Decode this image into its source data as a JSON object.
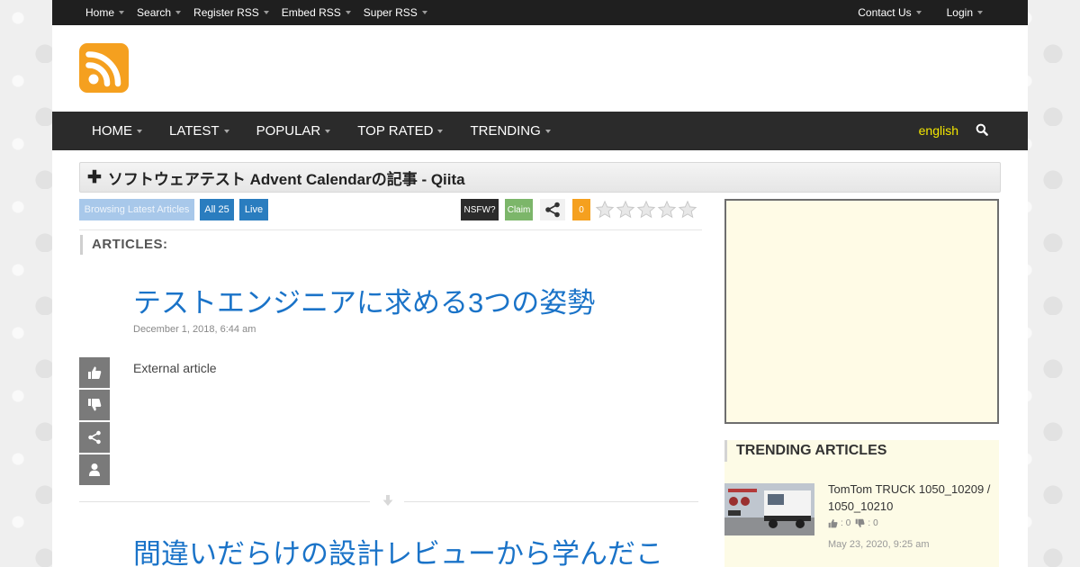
{
  "topbar": {
    "left": [
      "Home",
      "Search",
      "Register RSS",
      "Embed RSS",
      "Super RSS"
    ],
    "right": [
      "Contact Us",
      "Login"
    ]
  },
  "mainnav": {
    "items": [
      "HOME",
      "LATEST",
      "POPULAR",
      "TOP RATED",
      "TRENDING"
    ],
    "language": "english"
  },
  "feed": {
    "title": "ソフトウェアテスト Advent Calendarの記事 - Qiita"
  },
  "toolbar": {
    "browse_label": "Browsing Latest Articles",
    "all_label": "All 25",
    "live_label": "Live",
    "nsfw_label": "NSFW?",
    "claim_label": "Claim",
    "count": "0",
    "rating": 0
  },
  "articles_heading": "ARTICLES:",
  "articles": [
    {
      "title": "テストエンジニアに求める3つの姿勢",
      "date": "December 1, 2018, 6:44 am",
      "body": "External article"
    },
    {
      "title": "間違いだらけの設計レビューから学んだこ"
    }
  ],
  "sidebar": {
    "trending_heading": "TRENDING ARTICLES",
    "trending": [
      {
        "title": "TomTom TRUCK 1050_10209 / 1050_10210",
        "likes": "0",
        "dislikes": "0",
        "date": "May 23, 2020, 9:25 am"
      }
    ]
  },
  "colors": {
    "accent_orange": "#f5a01f",
    "link_blue": "#1a73c8",
    "nav_dark": "#2b2b2b",
    "language_yellow": "#f3e600"
  },
  "icons": [
    "rss-logo-icon",
    "search-icon",
    "thumbs-up-icon",
    "thumbs-down-icon",
    "share-icon",
    "user-icon",
    "arrow-down-icon",
    "star-icon"
  ]
}
